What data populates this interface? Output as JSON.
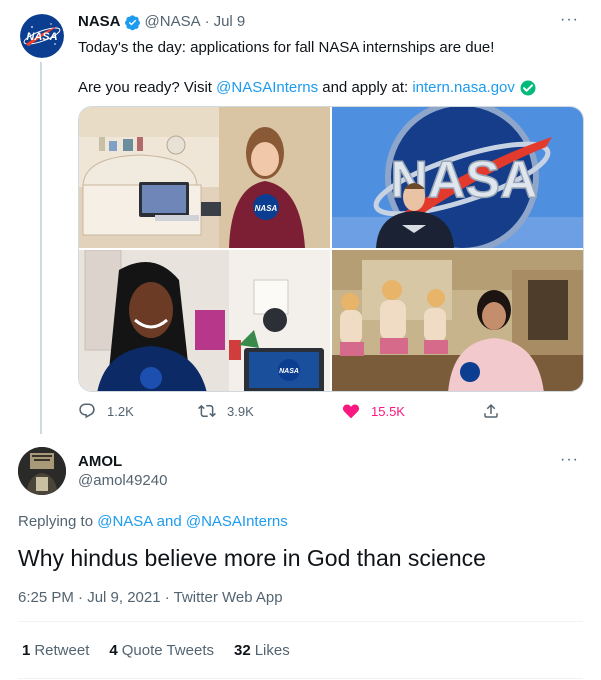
{
  "tweet": {
    "author_name": "NASA",
    "author_handle": "@NASA",
    "dot": "·",
    "date": "Jul 9",
    "text_line1": "Today's the day: applications for fall NASA internships are due!",
    "text_line2_prefix": "Are you ready? Visit",
    "mention_interns": "@NASAInterns",
    "text_line2_middle": "and apply at:",
    "link_url": "intern.nasa.gov",
    "more_label": "···",
    "actions": {
      "replies": "1.2K",
      "retweets": "3.9K",
      "likes": "15.5K"
    },
    "photos": [
      {
        "label": "intern-desk-photo",
        "logo_text": "NASA"
      },
      {
        "label": "nasa-sign-photo",
        "logo_text": "NASA"
      },
      {
        "label": "intern-laptop-photo",
        "logo_text": "NASA"
      },
      {
        "label": "intern-shrine-photo",
        "logo_text": "NASA"
      }
    ]
  },
  "reply": {
    "author_name": "AMOL",
    "author_handle": "@amol49240",
    "more_label": "···",
    "replying_prefix": "Replying to",
    "replying_mention1": "@NASA",
    "replying_and": "and",
    "replying_mention2": "@NASAInterns",
    "text": "Why hindus believe more in God than science",
    "timestamp": "6:25 PM · Jul 9, 2021 · Twitter Web App",
    "stats": {
      "retweets_count": "1",
      "retweets_label": "Retweet",
      "quotes_count": "4",
      "quotes_label": "Quote Tweets",
      "likes_count": "32",
      "likes_label": "Likes"
    }
  },
  "colors": {
    "link": "#1d9bf0",
    "like": "#f91880",
    "muted": "#536471",
    "verified": "#1d9bf0",
    "green_check": "#00ba7c"
  }
}
